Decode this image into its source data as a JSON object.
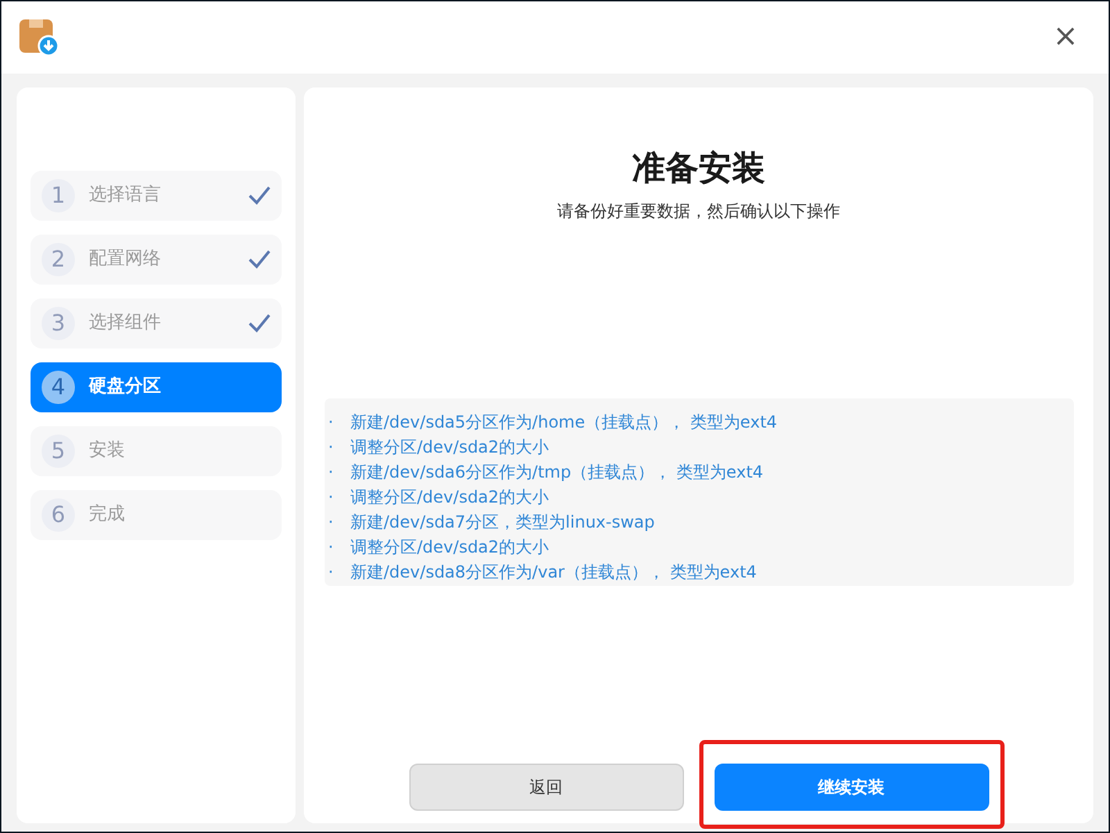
{
  "steps": [
    {
      "number": "1",
      "label": "选择语言",
      "done": true,
      "selected": false
    },
    {
      "number": "2",
      "label": "配置网络",
      "done": true,
      "selected": false
    },
    {
      "number": "3",
      "label": "选择组件",
      "done": true,
      "selected": false
    },
    {
      "number": "4",
      "label": "硬盘分区",
      "done": false,
      "selected": true
    },
    {
      "number": "5",
      "label": "安装",
      "done": false,
      "selected": false
    },
    {
      "number": "6",
      "label": "完成",
      "done": false,
      "selected": false
    }
  ],
  "heading": "准备安装",
  "subtitle": "请备份好重要数据，然后确认以下操作",
  "operations": [
    {
      "bullet": "·",
      "text": "新建/dev/sda5分区作为/home（挂载点）， 类型为ext4"
    },
    {
      "bullet": "·",
      "text": "调整分区/dev/sda2的大小"
    },
    {
      "bullet": "·",
      "text": "新建/dev/sda6分区作为/tmp（挂载点）， 类型为ext4"
    },
    {
      "bullet": "·",
      "text": "调整分区/dev/sda2的大小"
    },
    {
      "bullet": "·",
      "text": "新建/dev/sda7分区，类型为linux-swap"
    },
    {
      "bullet": "·",
      "text": "调整分区/dev/sda2的大小"
    },
    {
      "bullet": "·",
      "text": "新建/dev/sda8分区作为/var（挂载点）， 类型为ext4"
    }
  ],
  "buttons": [
    {
      "label": "返回",
      "kind": "secondary",
      "highlighted": false
    },
    {
      "label": "继续安装",
      "kind": "primary",
      "highlighted": true
    }
  ],
  "close_glyph": "×"
}
